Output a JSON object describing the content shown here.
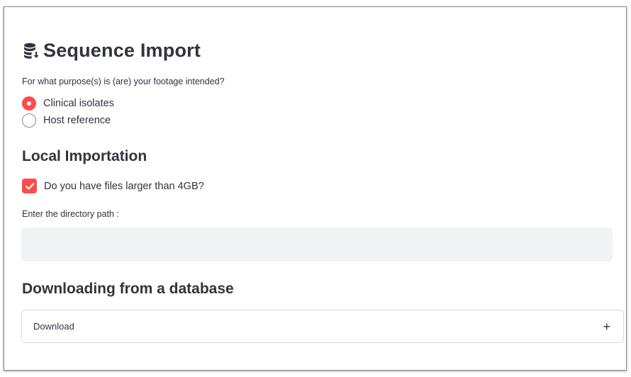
{
  "page": {
    "title": "Sequence Import",
    "title_icon": "database-download-icon"
  },
  "purpose": {
    "question": "For what purpose(s) is (are) your footage intended?",
    "options": [
      {
        "label": "Clinical isolates",
        "selected": true
      },
      {
        "label": "Host reference",
        "selected": false
      }
    ]
  },
  "local": {
    "heading": "Local Importation",
    "checkbox_label": "Do you have files larger than 4GB?",
    "checkbox_checked": true,
    "path_label": "Enter the directory path :",
    "path_value": ""
  },
  "database": {
    "heading": "Downloading from a database",
    "expander_label": "Download",
    "expander_icon": "plus-icon"
  },
  "colors": {
    "accent": "#ff4b4b",
    "text": "#31333f",
    "input_bg": "#f0f2f6"
  }
}
